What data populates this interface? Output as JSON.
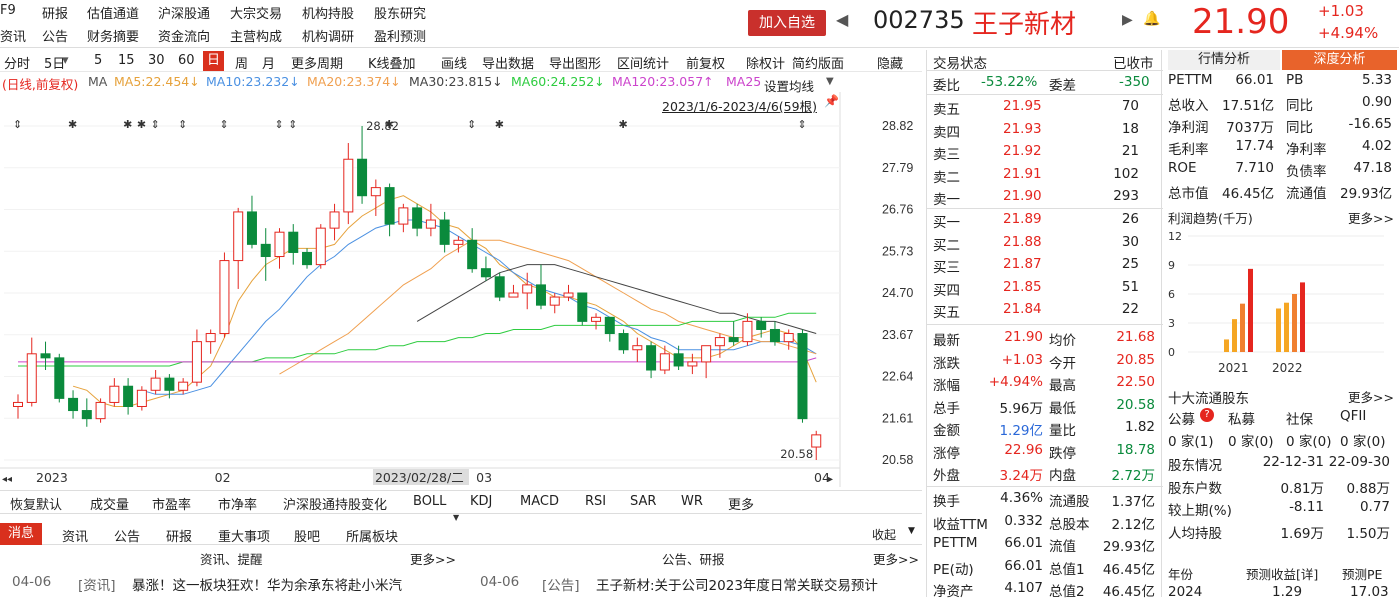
{
  "menu": {
    "items": [
      "F9",
      "研报",
      "估值通道",
      "沪深股通",
      "大宗交易",
      "机构持股",
      "股东研究"
    ],
    "items2": [
      "资讯",
      "公告",
      "财务摘要",
      "资金流向",
      "主营构成",
      "机构调研",
      "盈利预测"
    ]
  },
  "stock": {
    "add_label": "加入自选",
    "code": "002735",
    "name": "王子新材",
    "price": "21.90",
    "change": "+1.03",
    "change_pct": "+4.94%"
  },
  "toolbar": {
    "items": [
      "分时",
      "5日",
      "5",
      "15",
      "30",
      "60",
      "日",
      "周",
      "月",
      "更多周期",
      "K线叠加",
      "画线",
      "导出数据",
      "导出图形",
      "区间统计",
      "前复权",
      "除权计",
      "简约版面",
      "隐藏"
    ],
    "active": "日"
  },
  "ma": {
    "label_main": "(日线,前复权)",
    "ma": "MA",
    "ma5": "MA5:22.454↓",
    "ma10": "MA10:23.232↓",
    "ma20": "MA20:23.374↓",
    "ma30": "MA30:23.815↓",
    "ma60": "MA60:24.252↓",
    "ma120": "MA120:23.057↑",
    "ma25": "MA25",
    "settings": "设置均线",
    "range": "2023/1/6-2023/4/6(59根)"
  },
  "colors": {
    "up": "#e5261f",
    "down": "#0a8a3c",
    "ma5": "#e6a23c",
    "ma10": "#4a90e2",
    "ma20": "#f0a050",
    "ma30": "#444444",
    "ma60": "#2ecc40",
    "ma120": "#cc44cc"
  },
  "chart_data": {
    "type": "candlestick",
    "ylim": [
      20.58,
      28.82
    ],
    "y_ticks": [
      "28.82",
      "27.79",
      "26.76",
      "25.73",
      "24.70",
      "23.67",
      "22.64",
      "21.61",
      "20.58"
    ],
    "x_labels": [
      "2023",
      "02",
      "2023/02/28/二",
      "03",
      "04"
    ],
    "high_label": "28.82",
    "low_label": "20.58",
    "candles": [
      [
        21.9,
        22.2,
        21.6,
        22.0
      ],
      [
        22.0,
        23.6,
        21.9,
        23.2
      ],
      [
        23.2,
        23.5,
        22.8,
        23.1
      ],
      [
        23.1,
        23.2,
        22.0,
        22.1
      ],
      [
        22.1,
        22.3,
        21.6,
        21.8
      ],
      [
        21.8,
        22.1,
        21.4,
        21.6
      ],
      [
        21.6,
        22.1,
        21.5,
        22.0
      ],
      [
        22.0,
        22.6,
        21.9,
        22.4
      ],
      [
        22.4,
        22.6,
        21.7,
        21.9
      ],
      [
        21.9,
        22.4,
        21.8,
        22.3
      ],
      [
        22.3,
        22.8,
        22.2,
        22.6
      ],
      [
        22.6,
        22.7,
        22.1,
        22.3
      ],
      [
        22.3,
        22.6,
        22.2,
        22.5
      ],
      [
        22.5,
        23.8,
        22.4,
        23.5
      ],
      [
        23.5,
        23.8,
        23.2,
        23.7
      ],
      [
        23.7,
        25.7,
        23.6,
        25.5
      ],
      [
        25.5,
        26.8,
        24.8,
        26.7
      ],
      [
        26.7,
        27.1,
        25.8,
        25.9
      ],
      [
        25.9,
        26.3,
        25.0,
        25.6
      ],
      [
        25.6,
        26.3,
        25.3,
        26.2
      ],
      [
        26.2,
        26.4,
        25.4,
        25.7
      ],
      [
        25.7,
        25.8,
        25.3,
        25.4
      ],
      [
        25.4,
        26.4,
        25.3,
        26.3
      ],
      [
        26.3,
        26.9,
        26.0,
        26.7
      ],
      [
        26.7,
        28.4,
        26.4,
        28.0
      ],
      [
        28.0,
        28.82,
        26.9,
        27.1
      ],
      [
        27.1,
        27.5,
        26.6,
        27.3
      ],
      [
        27.3,
        27.4,
        26.1,
        26.4
      ],
      [
        26.4,
        26.9,
        26.2,
        26.8
      ],
      [
        26.8,
        26.9,
        26.1,
        26.3
      ],
      [
        26.3,
        26.9,
        26.1,
        26.5
      ],
      [
        26.5,
        26.7,
        25.7,
        25.9
      ],
      [
        25.9,
        26.1,
        25.7,
        26.0
      ],
      [
        26.0,
        26.3,
        25.2,
        25.3
      ],
      [
        25.3,
        25.6,
        25.0,
        25.1
      ],
      [
        25.1,
        25.2,
        24.5,
        24.6
      ],
      [
        24.6,
        24.9,
        24.6,
        24.7
      ],
      [
        24.7,
        25.2,
        24.3,
        24.9
      ],
      [
        24.9,
        25.4,
        24.3,
        24.4
      ],
      [
        24.4,
        24.7,
        24.2,
        24.6
      ],
      [
        24.6,
        24.9,
        24.5,
        24.7
      ],
      [
        24.7,
        24.7,
        23.9,
        24.0
      ],
      [
        24.0,
        24.2,
        23.8,
        24.1
      ],
      [
        24.1,
        24.1,
        23.5,
        23.7
      ],
      [
        23.7,
        23.8,
        23.2,
        23.3
      ],
      [
        23.3,
        23.6,
        23.0,
        23.4
      ],
      [
        23.4,
        23.5,
        22.6,
        22.8
      ],
      [
        22.8,
        23.4,
        22.7,
        23.2
      ],
      [
        23.2,
        23.4,
        22.8,
        22.9
      ],
      [
        22.9,
        23.2,
        22.7,
        23.0
      ],
      [
        23.0,
        23.3,
        22.6,
        23.4
      ],
      [
        23.4,
        23.7,
        23.1,
        23.6
      ],
      [
        23.6,
        24.0,
        23.4,
        23.5
      ],
      [
        23.5,
        24.2,
        23.4,
        24.0
      ],
      [
        24.0,
        24.1,
        23.6,
        23.8
      ],
      [
        23.8,
        24.0,
        23.4,
        23.5
      ],
      [
        23.5,
        23.8,
        23.3,
        23.7
      ],
      [
        23.7,
        23.8,
        21.5,
        21.6
      ],
      [
        20.9,
        21.3,
        20.58,
        21.2
      ]
    ],
    "ma_series": [
      {
        "name": "MA5",
        "color": "#e6a23c",
        "values": [
          null,
          null,
          null,
          null,
          22.4,
          22.3,
          22.0,
          21.9,
          21.9,
          22.0,
          22.1,
          22.2,
          22.3,
          22.6,
          22.9,
          23.6,
          24.5,
          25.0,
          25.4,
          25.6,
          25.8,
          25.8,
          25.8,
          25.9,
          26.3,
          26.6,
          26.8,
          27.0,
          27.1,
          26.9,
          26.7,
          26.4,
          26.3,
          26.0,
          25.8,
          25.4,
          25.2,
          24.9,
          24.8,
          24.6,
          24.6,
          24.5,
          24.4,
          24.2,
          24.0,
          23.7,
          23.5,
          23.3,
          23.1,
          23.1,
          23.1,
          23.2,
          23.4,
          23.6,
          23.7,
          23.8,
          23.7,
          23.3,
          22.5
        ]
      },
      {
        "name": "MA10",
        "color": "#4a90e2",
        "values": [
          null,
          null,
          null,
          null,
          null,
          null,
          null,
          null,
          null,
          22.3,
          22.2,
          22.2,
          22.2,
          22.3,
          22.4,
          22.8,
          23.2,
          23.6,
          24.0,
          24.3,
          24.7,
          25.1,
          25.4,
          25.6,
          25.9,
          26.1,
          26.3,
          26.4,
          26.5,
          26.5,
          26.4,
          26.3,
          26.1,
          25.9,
          25.7,
          25.5,
          25.2,
          25.0,
          24.8,
          24.7,
          24.6,
          24.4,
          24.3,
          24.1,
          23.9,
          23.8,
          23.6,
          23.5,
          23.3,
          23.3,
          23.3,
          23.3,
          23.3,
          23.4,
          23.5,
          23.5,
          23.5,
          23.4,
          23.2
        ]
      },
      {
        "name": "MA20",
        "color": "#f0a050",
        "values": [
          null,
          null,
          null,
          null,
          null,
          null,
          null,
          null,
          null,
          null,
          null,
          null,
          null,
          null,
          null,
          null,
          null,
          null,
          null,
          22.7,
          22.9,
          23.1,
          23.3,
          23.5,
          23.7,
          24.0,
          24.3,
          24.6,
          24.9,
          25.1,
          25.3,
          25.6,
          25.8,
          26.0,
          26.0,
          26.0,
          25.9,
          25.8,
          25.7,
          25.6,
          25.5,
          25.3,
          25.1,
          24.9,
          24.7,
          24.5,
          24.3,
          24.2,
          24.0,
          23.9,
          23.8,
          23.7,
          23.6,
          23.6,
          23.5,
          23.5,
          23.4,
          23.3,
          23.2
        ]
      },
      {
        "name": "MA30",
        "color": "#444444",
        "values": [
          null,
          null,
          null,
          null,
          null,
          null,
          null,
          null,
          null,
          null,
          null,
          null,
          null,
          null,
          null,
          null,
          null,
          null,
          null,
          null,
          null,
          null,
          null,
          null,
          null,
          null,
          null,
          null,
          null,
          24.0,
          24.2,
          24.4,
          24.6,
          24.8,
          25.0,
          25.2,
          25.3,
          25.4,
          25.4,
          25.4,
          25.3,
          25.2,
          25.1,
          25.0,
          24.9,
          24.8,
          24.7,
          24.6,
          24.5,
          24.4,
          24.3,
          24.2,
          24.2,
          24.1,
          24.0,
          24.0,
          23.9,
          23.8,
          23.7
        ]
      },
      {
        "name": "MA60",
        "color": "#2ecc40",
        "values": [
          22.9,
          22.9,
          22.9,
          22.9,
          22.9,
          22.9,
          22.9,
          22.9,
          22.9,
          22.9,
          22.9,
          22.9,
          23.0,
          23.0,
          23.0,
          23.0,
          23.0,
          23.0,
          23.1,
          23.1,
          23.1,
          23.2,
          23.2,
          23.2,
          23.3,
          23.3,
          23.3,
          23.4,
          23.4,
          23.5,
          23.5,
          23.5,
          23.6,
          23.6,
          23.7,
          23.7,
          23.8,
          23.8,
          23.8,
          23.9,
          23.9,
          23.9,
          23.9,
          23.9,
          23.9,
          23.9,
          23.9,
          23.9,
          23.9,
          24.0,
          24.0,
          24.0,
          24.0,
          24.1,
          24.1,
          24.1,
          24.2,
          24.2,
          24.2
        ]
      },
      {
        "name": "MA120",
        "color": "#cc44cc",
        "values": [
          23.0,
          23.0,
          23.0,
          23.0,
          23.0,
          23.0,
          23.0,
          23.0,
          23.0,
          23.0,
          23.0,
          23.0,
          23.0,
          23.0,
          23.0,
          23.0,
          23.0,
          23.0,
          23.0,
          23.0,
          23.0,
          23.0,
          23.0,
          23.0,
          23.0,
          23.0,
          23.0,
          23.0,
          23.0,
          23.0,
          23.0,
          23.0,
          23.0,
          23.0,
          23.0,
          23.0,
          23.0,
          23.0,
          23.0,
          23.0,
          23.0,
          23.0,
          23.0,
          23.0,
          23.0,
          23.0,
          23.0,
          23.0,
          23.0,
          23.0,
          23.0,
          23.0,
          23.0,
          23.0,
          23.0,
          23.0,
          23.0,
          23.0,
          23.1
        ]
      }
    ]
  },
  "bottom_tabs": [
    "恢复默认",
    "成交量",
    "市盈率",
    "市净率",
    "沪深股通持股变化",
    "BOLL",
    "KDJ",
    "MACD",
    "RSI",
    "SAR",
    "WR",
    "更多"
  ],
  "news_tabs": [
    "消息",
    "资讯",
    "公告",
    "研报",
    "重大事项",
    "股吧",
    "所属板块"
  ],
  "news_collapse": "收起",
  "news_header": {
    "left": "资讯、提醒",
    "left_more": "更多>>",
    "right": "公告、研报",
    "right_more": "更多>>"
  },
  "news": {
    "d1": "04-06",
    "t1": "[资讯]",
    "h1": "暴涨！这一板块狂欢！华为余承东将赴小米汽",
    "d2": "04-06",
    "t2": "[公告]",
    "h2": "王子新材:关于公司2023年度日常关联交易预计"
  },
  "quote": {
    "title": "交易状态",
    "status": "已收市",
    "weibi_l": "委比",
    "weibi": "-53.22%",
    "weicha_l": "委差",
    "weicha": "-350",
    "sells": [
      [
        "卖五",
        "21.95",
        "70"
      ],
      [
        "卖四",
        "21.93",
        "18"
      ],
      [
        "卖三",
        "21.92",
        "21"
      ],
      [
        "卖二",
        "21.91",
        "102"
      ],
      [
        "卖一",
        "21.90",
        "293"
      ]
    ],
    "buys": [
      [
        "买一",
        "21.89",
        "26"
      ],
      [
        "买二",
        "21.88",
        "30"
      ],
      [
        "买三",
        "21.87",
        "25"
      ],
      [
        "买四",
        "21.85",
        "51"
      ],
      [
        "买五",
        "21.84",
        "22"
      ]
    ],
    "stats": [
      [
        "最新",
        "21.90",
        "均价",
        "21.68"
      ],
      [
        "涨跌",
        "+1.03",
        "今开",
        "20.85"
      ],
      [
        "涨幅",
        "+4.94%",
        "最高",
        "22.50"
      ],
      [
        "总手",
        "5.96万",
        "最低",
        "20.58"
      ],
      [
        "金额",
        "1.29亿",
        "量比",
        "1.82"
      ],
      [
        "涨停",
        "22.96",
        "跌停",
        "18.78"
      ],
      [
        "外盘",
        "3.24万",
        "内盘",
        "2.72万"
      ]
    ],
    "stats2": [
      [
        "换手",
        "4.36%",
        "流通股",
        "1.37亿"
      ],
      [
        "收益TTM",
        "0.332",
        "总股本",
        "2.12亿"
      ],
      [
        "PETTM",
        "66.01",
        "流值",
        "29.93亿"
      ],
      [
        "PE(动)",
        "66.01",
        "总值1",
        "46.45亿"
      ],
      [
        "净资产",
        "4.107",
        "总值2",
        "46.45亿"
      ]
    ]
  },
  "fin": {
    "tab1": "行情分析",
    "tab2": "深度分析",
    "rows": [
      [
        "PETTM",
        "66.01",
        "PB",
        "5.33"
      ],
      [
        "总收入",
        "17.51亿",
        "同比",
        "0.90"
      ],
      [
        "净利润",
        "7037万",
        "同比",
        "-16.65"
      ],
      [
        "毛利率",
        "17.74",
        "净利率",
        "4.02"
      ],
      [
        "ROE",
        "7.710",
        "负债率",
        "47.18"
      ],
      [
        "总市值",
        "46.45亿",
        "流通值",
        "29.93亿"
      ]
    ],
    "profit_title": "利润趋势(千万)",
    "more": "更多>>",
    "years": [
      "2021",
      "2022"
    ],
    "yticks": [
      "12",
      "9",
      "6",
      "3",
      "0"
    ],
    "shareholders_title": "十大流通股东",
    "sh_cols": [
      "公募",
      "私募",
      "社保",
      "QFII"
    ],
    "sh_vals": [
      "0 家(1)",
      "0 家(0)",
      "0 家(0)",
      "0 家(0)"
    ],
    "holders": [
      [
        "股东情况",
        "22-12-31",
        "22-09-30"
      ],
      [
        "股东户数",
        "0.81万",
        "0.88万"
      ],
      [
        "较上期(%)",
        "-8.11",
        "0.77"
      ],
      [
        "人均持股",
        "1.69万",
        "1.50万"
      ]
    ],
    "forecast": [
      "年份",
      "预测收益[详]",
      "预测PE"
    ],
    "forecast_row": [
      "2024",
      "1.29",
      "17.03"
    ]
  }
}
